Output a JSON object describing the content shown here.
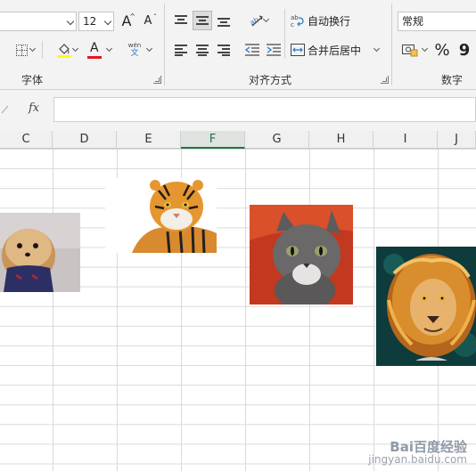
{
  "ribbon": {
    "font_group": {
      "label": "字体",
      "font_size": "12",
      "grow_font": "A",
      "shrink_font": "A",
      "phonetic_top": "wén",
      "phonetic_bottom": "文",
      "font_color_letter": "A",
      "fill_color": "#ffff00",
      "font_color": "#e81123"
    },
    "alignment_group": {
      "label": "对齐方式",
      "wrap_text": "自动换行",
      "merge_center": "合并后居中",
      "orientation_icon": "ab"
    },
    "number_group": {
      "label": "数字",
      "format": "常规",
      "percent": "%",
      "comma": "9"
    }
  },
  "formula_bar": {
    "fx": "fx",
    "content": ""
  },
  "columns": [
    "C",
    "D",
    "E",
    "F",
    "G",
    "H",
    "I",
    "J"
  ],
  "selected_column": "F",
  "pictures": [
    {
      "name": "pomeranian-dog-photo"
    },
    {
      "name": "tiger-photo"
    },
    {
      "name": "gray-kitten-photo"
    },
    {
      "name": "lion-painting"
    }
  ],
  "watermark": {
    "line1": "Bai百度经验",
    "line2": "jingyan.baidu.com"
  }
}
